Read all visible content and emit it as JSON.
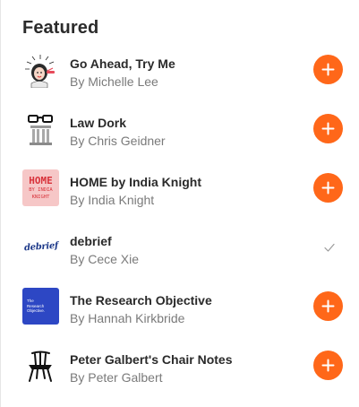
{
  "accent": "#ff6719",
  "heading": "Featured",
  "items": [
    {
      "title": "Go Ahead, Try Me",
      "author": "By Michelle Lee",
      "icon": "portrait-illustration-icon",
      "subscribed": false
    },
    {
      "title": "Law Dork",
      "author": "By Chris Geidner",
      "icon": "glasses-column-icon",
      "subscribed": false
    },
    {
      "title": "HOME by India Knight",
      "author": "By India Knight",
      "icon": "home-text-logo",
      "logo_lines": [
        "HOME",
        "BY INDIA",
        "KNIGHT"
      ],
      "subscribed": false
    },
    {
      "title": "debrief",
      "author": "By Cece Xie",
      "icon": "debrief-wordmark",
      "logo_text": "debrief",
      "subscribed": true
    },
    {
      "title": "The Research Objective",
      "author": "By Hannah Kirkbride",
      "icon": "research-objective-logo",
      "logo_text": "The Research Objective.",
      "subscribed": false
    },
    {
      "title": "Peter Galbert's Chair Notes",
      "author": "By Peter Galbert",
      "icon": "chair-icon",
      "subscribed": false
    }
  ]
}
